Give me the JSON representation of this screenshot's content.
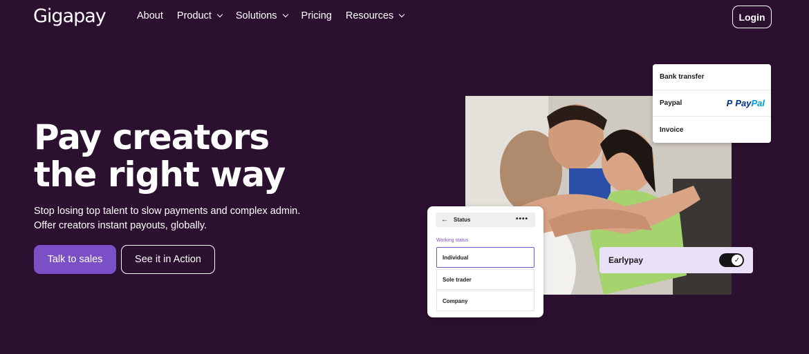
{
  "brand": {
    "name": "Gigapay"
  },
  "nav": {
    "items": [
      {
        "label": "About",
        "has_dropdown": false
      },
      {
        "label": "Product",
        "has_dropdown": true
      },
      {
        "label": "Solutions",
        "has_dropdown": true
      },
      {
        "label": "Pricing",
        "has_dropdown": false
      },
      {
        "label": "Resources",
        "has_dropdown": true
      }
    ],
    "login_label": "Login"
  },
  "hero": {
    "title_line1": "Pay creators",
    "title_line2": "the right way",
    "subtitle_line1": "Stop losing top talent to slow payments and complex admin.",
    "subtitle_line2": "Offer creators instant payouts, globally.",
    "primary_button": "Talk to sales",
    "secondary_button": "See it in Action"
  },
  "payment_methods": {
    "items": [
      "Bank transfer",
      "Paypal",
      "Invoice"
    ],
    "paypal_logo_part1": "Pay",
    "paypal_logo_part2": "Pal"
  },
  "status_card": {
    "header": "Status",
    "field_label": "Working status",
    "options": [
      "Individual",
      "Sole trader",
      "Company"
    ],
    "selected": "Individual"
  },
  "earlypay": {
    "label": "Earlypay",
    "enabled": true
  },
  "colors": {
    "background": "#2c1030",
    "accent": "#7b4fc6",
    "earlypay_bg": "#e9e1f7"
  }
}
